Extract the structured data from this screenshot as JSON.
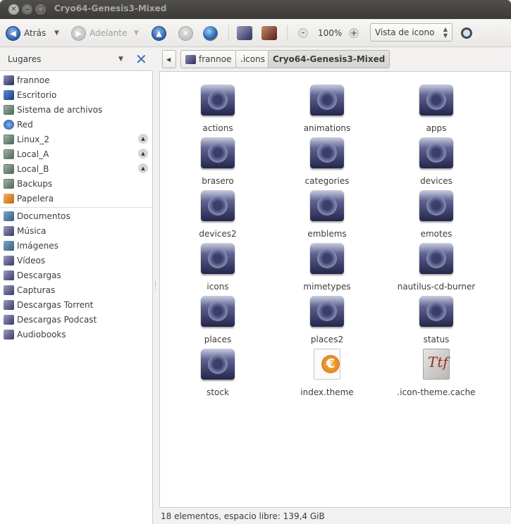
{
  "window": {
    "title": "Cryo64-Genesis3-Mixed"
  },
  "toolbar": {
    "back_label": "Atrás",
    "forward_label": "Adelante",
    "zoom_value": "100%",
    "view_mode": "Vista de icono"
  },
  "sidebar": {
    "header": "Lugares",
    "places": [
      {
        "label": "frannoe",
        "icon": "user-home-icon"
      },
      {
        "label": "Escritorio",
        "icon": "desktop-icon"
      },
      {
        "label": "Sistema de archivos",
        "icon": "filesystem-icon"
      },
      {
        "label": "Red",
        "icon": "network-icon"
      },
      {
        "label": "Linux_2",
        "icon": "drive-icon",
        "eject": true
      },
      {
        "label": "Local_A",
        "icon": "drive-icon",
        "eject": true
      },
      {
        "label": "Local_B",
        "icon": "drive-icon",
        "eject": true
      },
      {
        "label": "Backups",
        "icon": "drive-icon"
      },
      {
        "label": "Papelera",
        "icon": "trash-icon"
      }
    ],
    "bookmarks": [
      {
        "label": "Documentos"
      },
      {
        "label": "Música"
      },
      {
        "label": "Imágenes"
      },
      {
        "label": "Vídeos"
      },
      {
        "label": "Descargas"
      },
      {
        "label": "Capturas"
      },
      {
        "label": "Descargas Torrent"
      },
      {
        "label": "Descargas Podcast"
      },
      {
        "label": "Audiobooks"
      }
    ]
  },
  "pathbar": {
    "segments": [
      "frannoe",
      ".icons",
      "Cryo64-Genesis3-Mixed"
    ]
  },
  "files": [
    {
      "name": "actions",
      "type": "folder"
    },
    {
      "name": "animations",
      "type": "folder"
    },
    {
      "name": "apps",
      "type": "folder"
    },
    {
      "name": "brasero",
      "type": "folder"
    },
    {
      "name": "categories",
      "type": "folder"
    },
    {
      "name": "devices",
      "type": "folder"
    },
    {
      "name": "devices2",
      "type": "folder"
    },
    {
      "name": "emblems",
      "type": "folder"
    },
    {
      "name": "emotes",
      "type": "folder"
    },
    {
      "name": "icons",
      "type": "folder"
    },
    {
      "name": "mimetypes",
      "type": "folder"
    },
    {
      "name": "nautilus-cd-burner",
      "type": "folder"
    },
    {
      "name": "places",
      "type": "folder"
    },
    {
      "name": "places2",
      "type": "folder"
    },
    {
      "name": "status",
      "type": "folder"
    },
    {
      "name": "stock",
      "type": "folder"
    },
    {
      "name": "index.theme",
      "type": "text"
    },
    {
      "name": ".icon-theme.cache",
      "type": "font"
    }
  ],
  "statusbar": {
    "text": "18 elementos, espacio libre: 139,4 GiB"
  }
}
